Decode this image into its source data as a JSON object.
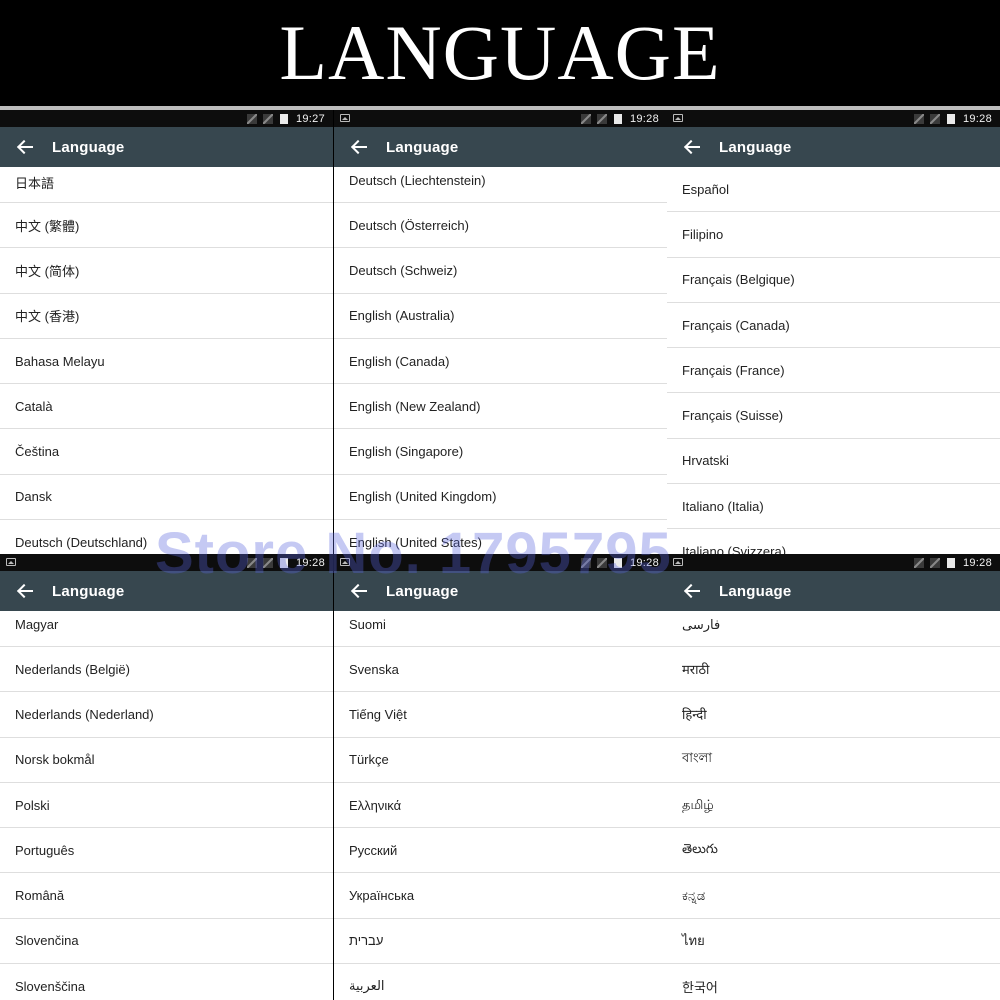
{
  "banner": {
    "title": "LANGUAGE"
  },
  "screens": [
    {
      "time": "19:27",
      "title": "Language",
      "items": [
        "日本語",
        "中文 (繁體)",
        "中文 (简体)",
        "中文 (香港)",
        "Bahasa Melayu",
        "Català",
        "Čeština",
        "Dansk",
        "Deutsch (Deutschland)"
      ]
    },
    {
      "time": "19:28",
      "title": "Language",
      "items": [
        "Deutsch (Liechtenstein)",
        "Deutsch (Österreich)",
        "Deutsch (Schweiz)",
        "English (Australia)",
        "English (Canada)",
        "English (New Zealand)",
        "English (Singapore)",
        "English (United Kingdom)",
        "English (United States)"
      ]
    },
    {
      "time": "19:28",
      "title": "Language",
      "items": [
        "Español",
        "Filipino",
        "Français (Belgique)",
        "Français (Canada)",
        "Français (France)",
        "Français (Suisse)",
        "Hrvatski",
        "Italiano (Italia)",
        "Italiano (Svizzera)"
      ]
    },
    {
      "time": "19:28",
      "title": "Language",
      "items": [
        "Magyar",
        "Nederlands (België)",
        "Nederlands (Nederland)",
        "Norsk bokmål",
        "Polski",
        "Português",
        "Română",
        "Slovenčina",
        "Slovenščina"
      ]
    },
    {
      "time": "19:28",
      "title": "Language",
      "items": [
        "Suomi",
        "Svenska",
        "Tiếng Việt",
        "Türkçe",
        "Ελληνικά",
        "Русский",
        "Українська",
        "עברית",
        "العربية"
      ]
    },
    {
      "time": "19:28",
      "title": "Language",
      "items": [
        "فارسی",
        "मराठी",
        "हिन्दी",
        "বাংলা",
        "தமிழ்",
        "తెలుగు",
        "ಕನ್ನಡ",
        "ไทย",
        "한국어"
      ]
    }
  ],
  "watermark": "Store No. 1795795"
}
